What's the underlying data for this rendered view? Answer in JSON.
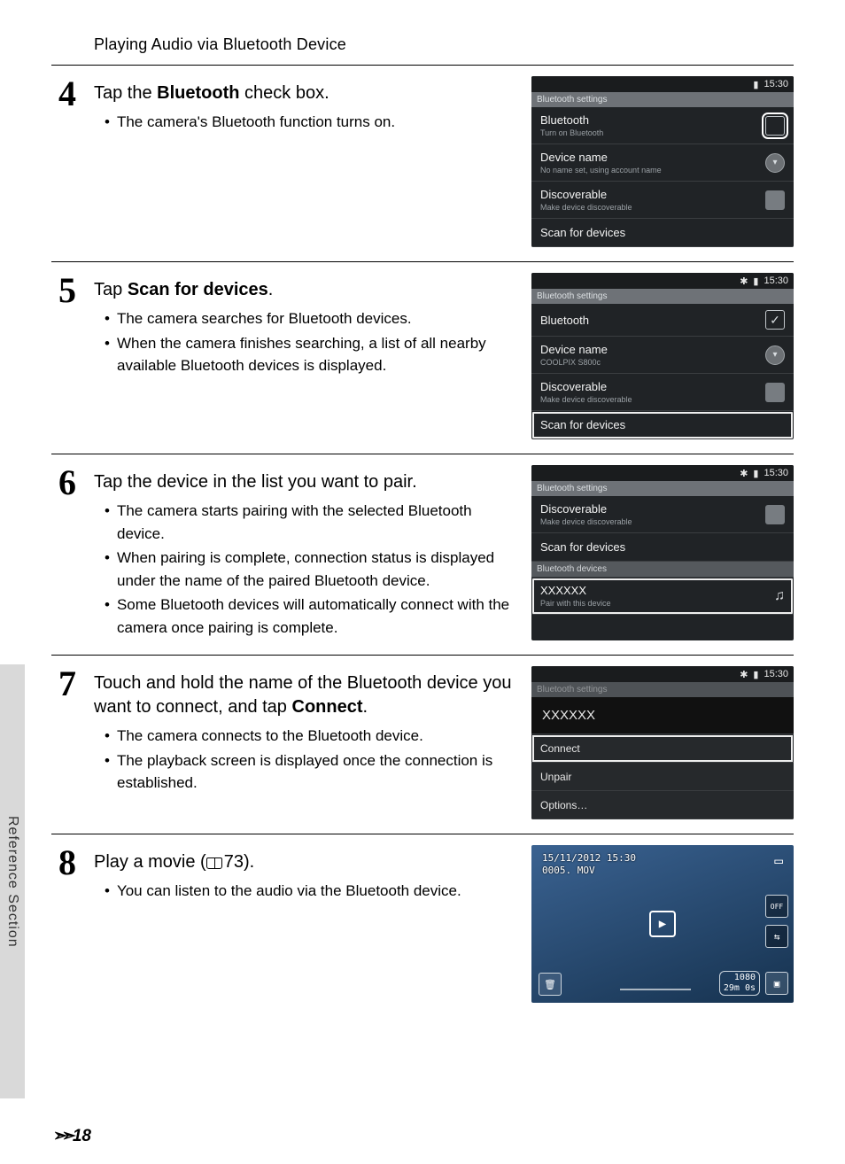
{
  "page_title": "Playing Audio via Bluetooth Device",
  "sidebar_label": "Reference Section",
  "page_num_prefix": "",
  "page_num": "18",
  "steps": {
    "s4": {
      "num": "4",
      "heading_pre": "Tap the ",
      "heading_bold": "Bluetooth",
      "heading_post": " check box.",
      "bullets": [
        "The camera's Bluetooth function turns on."
      ],
      "screen": {
        "time": "15:30",
        "bt_icon": "",
        "crumb": "Bluetooth settings",
        "rows": [
          {
            "title": "Bluetooth",
            "sub": "Turn on Bluetooth",
            "ctrl": "checkbox-hl"
          },
          {
            "title": "Device name",
            "sub": "No name set, using account name",
            "ctrl": "round"
          },
          {
            "title": "Discoverable",
            "sub": "Make device discoverable",
            "ctrl": "box-empty"
          },
          {
            "title": "Scan for devices",
            "sub": "",
            "ctrl": ""
          }
        ]
      }
    },
    "s5": {
      "num": "5",
      "heading_pre": "Tap ",
      "heading_bold": "Scan for devices",
      "heading_post": ".",
      "bullets": [
        "The camera searches for Bluetooth devices.",
        "When the camera finishes searching, a list of all nearby available Bluetooth devices is displayed."
      ],
      "screen": {
        "time": "15:30",
        "crumb": "Bluetooth settings",
        "rows": [
          {
            "title": "Bluetooth",
            "sub": "",
            "ctrl": "checked"
          },
          {
            "title": "Device name",
            "sub": "COOLPIX S800c",
            "ctrl": "round"
          },
          {
            "title": "Discoverable",
            "sub": "Make device discoverable",
            "ctrl": "box-empty"
          },
          {
            "title": "Scan for devices",
            "sub": "",
            "ctrl": "",
            "hl": true
          }
        ]
      }
    },
    "s6": {
      "num": "6",
      "heading_pre": "Tap the device in the list you want to pair.",
      "heading_bold": "",
      "heading_post": "",
      "bullets": [
        "The camera starts pairing with the selected Bluetooth device.",
        "When pairing is complete, connection status is displayed under the name of the paired Bluetooth device.",
        "Some Bluetooth devices will automatically connect with the camera once pairing is complete."
      ],
      "screen": {
        "time": "15:30",
        "crumb": "Bluetooth settings",
        "rows": [
          {
            "title": "Discoverable",
            "sub": "Make device discoverable",
            "ctrl": "box-empty"
          },
          {
            "title": "Scan for devices",
            "sub": "",
            "ctrl": ""
          }
        ],
        "section": "Bluetooth devices",
        "device": {
          "title": "XXXXXX",
          "sub": "Pair with this device",
          "hl": true
        }
      }
    },
    "s7": {
      "num": "7",
      "heading_pre": "Touch and hold the name of the Bluetooth device you want to connect, and tap ",
      "heading_bold": "Connect",
      "heading_post": ".",
      "bullets": [
        "The camera connects to the Bluetooth device.",
        "The playback screen is displayed once the connection is established."
      ],
      "screen": {
        "time": "15:30",
        "crumb": "Bluetooth settings",
        "menu": {
          "header": "XXXXXX",
          "items": [
            {
              "label": "Connect",
              "hl": true
            },
            {
              "label": "Unpair"
            },
            {
              "label": "Options…"
            }
          ]
        }
      }
    },
    "s8": {
      "num": "8",
      "heading_pre": "Play a movie (",
      "heading_icon": "book",
      "heading_ref": "73",
      "heading_post": ").",
      "bullets": [
        "You can listen to the audio via the Bluetooth device."
      ],
      "playback": {
        "datetime": "15/11/2012 15:30",
        "file": "0005. MOV",
        "wifi_label": "OFF",
        "res": "1080",
        "time_remaining": "29m 0s"
      }
    }
  }
}
